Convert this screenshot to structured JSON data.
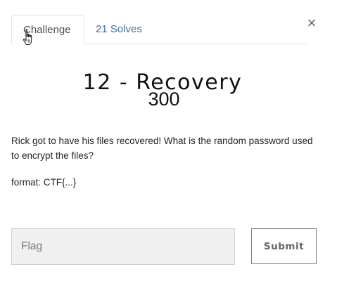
{
  "tabs": [
    {
      "label": "Challenge",
      "active": true
    },
    {
      "label": "21 Solves",
      "active": false
    }
  ],
  "close_glyph": "×",
  "challenge": {
    "title": "12 - Recovery",
    "points": "300",
    "description": "Rick got to have his files recovered! What is the random password used to encrypt the files?",
    "format": "format: CTF{...}"
  },
  "flag": {
    "placeholder": "Flag",
    "value": ""
  },
  "submit_label": "Submit",
  "icons": {
    "close": "close-icon",
    "cursor": "hand-pointer-icon"
  },
  "colors": {
    "inactive_tab": "#3f6fa8",
    "border": "#dee2e6",
    "input_bg": "#f0f0f0"
  }
}
